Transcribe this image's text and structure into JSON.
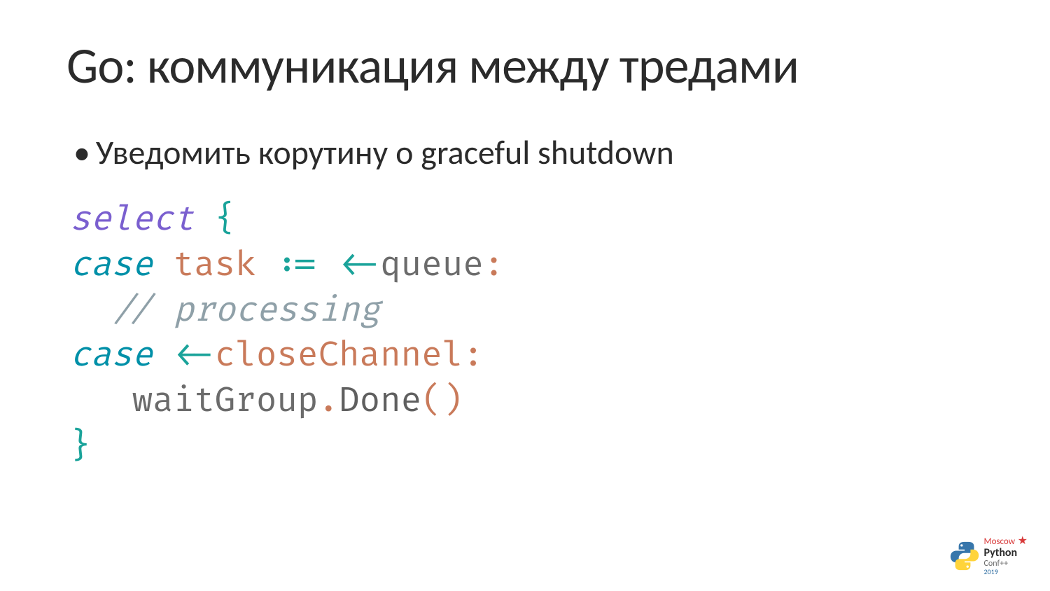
{
  "title": "Go: коммуникация между тредами",
  "bullet": "Уведомить корутину о graceful shutdown",
  "code": {
    "line1": {
      "select": "select",
      "space": " ",
      "brace": "{"
    },
    "line2": {
      "case": "case",
      "space": " ",
      "task": "task",
      "assign": " := ",
      "arrow": "<-",
      "queue": "queue",
      "colon": ":"
    },
    "line3": {
      "indent": "  ",
      "comment": "// processing"
    },
    "line4": {
      "case": "case",
      "space": " ",
      "arrow": "<-",
      "close": "closeChannel",
      "colon": ":"
    },
    "line5": {
      "indent": "   ",
      "wait": "waitGroup",
      "dot": ".",
      "method": "Done",
      "paren_open": "(",
      "paren_close": ")"
    },
    "line6": {
      "brace": "}"
    }
  },
  "logo": {
    "moscow": "Moscow",
    "star": "★",
    "python": "Python",
    "conf": "Conf++",
    "year": "2019"
  }
}
